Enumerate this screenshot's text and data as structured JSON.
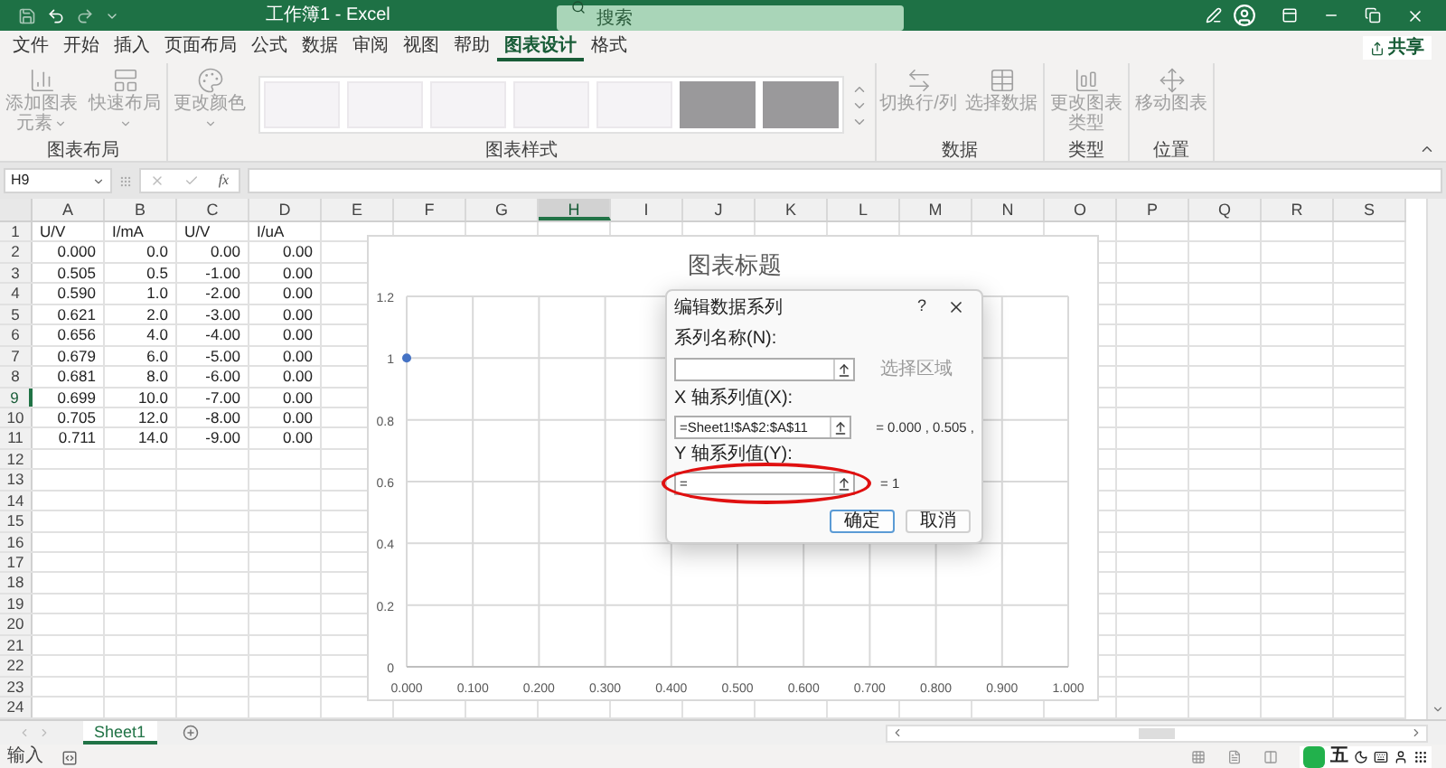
{
  "title_bar": {
    "title": "工作簿1 - Excel",
    "search": {
      "placeholder": "搜索"
    }
  },
  "ribbon_tabs": [
    {
      "label": "文件",
      "selected": false
    },
    {
      "label": "开始",
      "selected": false
    },
    {
      "label": "插入",
      "selected": false
    },
    {
      "label": "页面布局",
      "selected": false
    },
    {
      "label": "公式",
      "selected": false
    },
    {
      "label": "数据",
      "selected": false
    },
    {
      "label": "审阅",
      "selected": false
    },
    {
      "label": "视图",
      "selected": false
    },
    {
      "label": "帮助",
      "selected": false
    },
    {
      "label": "图表设计",
      "selected": true
    },
    {
      "label": "格式",
      "selected": false
    }
  ],
  "share_button": "共享",
  "ribbon_groups": [
    {
      "label": "图表布局",
      "items": [
        {
          "kind": "button",
          "label": "添加图表元素",
          "disabled": true,
          "dropdown": true
        },
        {
          "kind": "button",
          "label": "快速布局",
          "disabled": true,
          "dropdown": true
        }
      ]
    },
    {
      "label": "图表样式",
      "items": [
        {
          "kind": "button",
          "label": "更改颜色",
          "disabled": true,
          "dropdown": true
        },
        {
          "kind": "gallery",
          "styles": [
            {
              "kind": "light"
            },
            {
              "kind": "light"
            },
            {
              "kind": "light"
            },
            {
              "kind": "light"
            },
            {
              "kind": "light"
            },
            {
              "kind": "dark"
            },
            {
              "kind": "dark"
            }
          ]
        }
      ]
    },
    {
      "label": "数据",
      "items": [
        {
          "kind": "button",
          "label": "切换行/列",
          "disabled": true,
          "dropdown": false
        },
        {
          "kind": "button",
          "label": "选择数据",
          "disabled": true,
          "dropdown": false
        }
      ]
    },
    {
      "label": "类型",
      "items": [
        {
          "kind": "button",
          "label": "更改图表类型",
          "disabled": true,
          "dropdown": false
        }
      ]
    },
    {
      "label": "位置",
      "items": [
        {
          "kind": "button",
          "label": "移动图表",
          "disabled": true,
          "dropdown": false
        }
      ]
    }
  ],
  "formula_bar": {
    "name_box": "H9",
    "fx_label": "fx"
  },
  "sheet": {
    "columns": [
      {
        "label": "A",
        "selected": false
      },
      {
        "label": "B",
        "selected": false
      },
      {
        "label": "C",
        "selected": false
      },
      {
        "label": "D",
        "selected": false
      },
      {
        "label": "E",
        "selected": false
      },
      {
        "label": "F",
        "selected": false
      },
      {
        "label": "G",
        "selected": false
      },
      {
        "label": "H",
        "selected": true
      },
      {
        "label": "I",
        "selected": false
      },
      {
        "label": "J",
        "selected": false
      },
      {
        "label": "K",
        "selected": false
      },
      {
        "label": "L",
        "selected": false
      },
      {
        "label": "M",
        "selected": false
      },
      {
        "label": "N",
        "selected": false
      },
      {
        "label": "O",
        "selected": false
      },
      {
        "label": "P",
        "selected": false
      },
      {
        "label": "Q",
        "selected": false
      },
      {
        "label": "R",
        "selected": false
      },
      {
        "label": "S",
        "selected": false
      }
    ],
    "rows": [
      {
        "header": "1",
        "selected": false,
        "kind": "text",
        "cells": [
          "U/V",
          "I/mA",
          "U/V",
          "I/uA"
        ]
      },
      {
        "header": "2",
        "selected": false,
        "kind": "number",
        "cells": [
          "0.000",
          "0.0",
          "0.00",
          "0.00"
        ]
      },
      {
        "header": "3",
        "selected": false,
        "kind": "number",
        "cells": [
          "0.505",
          "0.5",
          "-1.00",
          "0.00"
        ]
      },
      {
        "header": "4",
        "selected": false,
        "kind": "number",
        "cells": [
          "0.590",
          "1.0",
          "-2.00",
          "0.00"
        ]
      },
      {
        "header": "5",
        "selected": false,
        "kind": "number",
        "cells": [
          "0.621",
          "2.0",
          "-3.00",
          "0.00"
        ]
      },
      {
        "header": "6",
        "selected": false,
        "kind": "number",
        "cells": [
          "0.656",
          "4.0",
          "-4.00",
          "0.00"
        ]
      },
      {
        "header": "7",
        "selected": false,
        "kind": "number",
        "cells": [
          "0.679",
          "6.0",
          "-5.00",
          "0.00"
        ]
      },
      {
        "header": "8",
        "selected": false,
        "kind": "number",
        "cells": [
          "0.681",
          "8.0",
          "-6.00",
          "0.00"
        ]
      },
      {
        "header": "9",
        "selected": true,
        "kind": "number",
        "cells": [
          "0.699",
          "10.0",
          "-7.00",
          "0.00"
        ]
      },
      {
        "header": "10",
        "selected": false,
        "kind": "number",
        "cells": [
          "0.705",
          "12.0",
          "-8.00",
          "0.00"
        ]
      },
      {
        "header": "11",
        "selected": false,
        "kind": "number",
        "cells": [
          "0.711",
          "14.0",
          "-9.00",
          "0.00"
        ]
      },
      {
        "header": "12",
        "selected": false
      },
      {
        "header": "13",
        "selected": false
      },
      {
        "header": "14",
        "selected": false
      },
      {
        "header": "15",
        "selected": false
      },
      {
        "header": "16",
        "selected": false
      },
      {
        "header": "17",
        "selected": false
      },
      {
        "header": "18",
        "selected": false
      },
      {
        "header": "19",
        "selected": false
      },
      {
        "header": "20",
        "selected": false
      },
      {
        "header": "21",
        "selected": false
      },
      {
        "header": "22",
        "selected": false
      },
      {
        "header": "23",
        "selected": false
      },
      {
        "header": "24",
        "selected": false
      }
    ]
  },
  "chart": {
    "chart_data": {
      "type": "scatter",
      "title": "图表标题",
      "x": [
        0
      ],
      "series": [
        {
          "color": "#4472c4",
          "values": [
            1
          ]
        }
      ],
      "xlim": [
        0,
        1
      ],
      "ylim": [
        0,
        1.2
      ],
      "xticks": [
        {
          "value": 0,
          "label": "0.000"
        },
        {
          "value": 0.1,
          "label": "0.100"
        },
        {
          "value": 0.2,
          "label": "0.200"
        },
        {
          "value": 0.3,
          "label": "0.300"
        },
        {
          "value": 0.4,
          "label": "0.400"
        },
        {
          "value": 0.5,
          "label": "0.500"
        },
        {
          "value": 0.6,
          "label": "0.600"
        },
        {
          "value": 0.7,
          "label": "0.700"
        },
        {
          "value": 0.8,
          "label": "0.800"
        },
        {
          "value": 0.9,
          "label": "0.900"
        },
        {
          "value": 1,
          "label": "1.000"
        }
      ],
      "yticks": [
        0,
        0.2,
        0.4,
        0.6,
        0.8,
        1,
        1.2
      ],
      "grid": true
    }
  },
  "dialog": {
    "title": "编辑数据系列",
    "help": "?",
    "fields": [
      {
        "label": "系列名称(N):",
        "note": "选择区域",
        "dimmed": true,
        "highlighted": false
      },
      {
        "label": "X 轴系列值(X):",
        "value": "=Sheet1!$A$2:$A$11",
        "note": "= 0.000 , 0.505 ,",
        "dimmed": false,
        "highlighted": false
      },
      {
        "label": "Y 轴系列值(Y):",
        "value": "=",
        "note": "= 1",
        "dimmed": false,
        "highlighted": true
      }
    ],
    "buttons": [
      {
        "label": "确定",
        "default": true
      },
      {
        "label": "取消",
        "default": false
      }
    ]
  },
  "sheet_tabs": [
    {
      "label": "Sheet1",
      "selected": true
    }
  ],
  "status_bar": {
    "mode": "输入",
    "ime_label": "五"
  }
}
